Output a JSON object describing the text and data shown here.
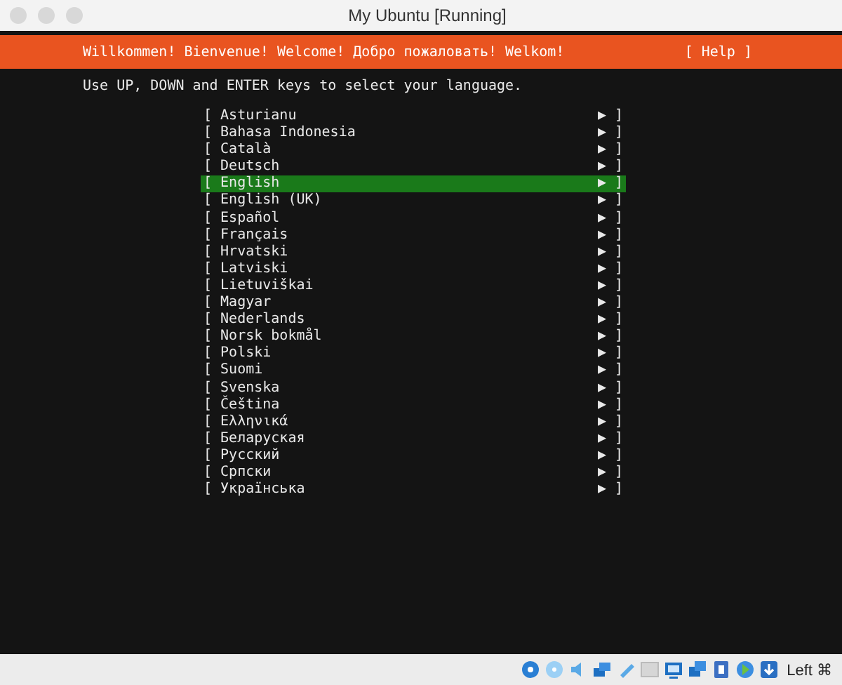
{
  "window": {
    "title": "My Ubuntu [Running]"
  },
  "header": {
    "welcome": "Willkommen! Bienvenue! Welcome! Добро пожаловать! Welkom!",
    "help": "[ Help ]"
  },
  "instruction": "Use UP, DOWN and ENTER keys to select your language.",
  "languages": [
    {
      "open": "[",
      "label": "Asturianu",
      "close": "▶ ]",
      "selected": false
    },
    {
      "open": "[",
      "label": "Bahasa Indonesia",
      "close": "▶ ]",
      "selected": false
    },
    {
      "open": "[",
      "label": "Català",
      "close": "▶ ]",
      "selected": false
    },
    {
      "open": "[",
      "label": "Deutsch",
      "close": "▶ ]",
      "selected": false
    },
    {
      "open": "[",
      "label": "English",
      "close": "▶ ]",
      "selected": true
    },
    {
      "open": "[",
      "label": "English (UK)",
      "close": "▶ ]",
      "selected": false
    },
    {
      "open": "[",
      "label": "Español",
      "close": "▶ ]",
      "selected": false
    },
    {
      "open": "[",
      "label": "Français",
      "close": "▶ ]",
      "selected": false
    },
    {
      "open": "[",
      "label": "Hrvatski",
      "close": "▶ ]",
      "selected": false
    },
    {
      "open": "[",
      "label": "Latviski",
      "close": "▶ ]",
      "selected": false
    },
    {
      "open": "[",
      "label": "Lietuviškai",
      "close": "▶ ]",
      "selected": false
    },
    {
      "open": "[",
      "label": "Magyar",
      "close": "▶ ]",
      "selected": false
    },
    {
      "open": "[",
      "label": "Nederlands",
      "close": "▶ ]",
      "selected": false
    },
    {
      "open": "[",
      "label": "Norsk bokmål",
      "close": "▶ ]",
      "selected": false
    },
    {
      "open": "[",
      "label": "Polski",
      "close": "▶ ]",
      "selected": false
    },
    {
      "open": "[",
      "label": "Suomi",
      "close": "▶ ]",
      "selected": false
    },
    {
      "open": "[",
      "label": "Svenska",
      "close": "▶ ]",
      "selected": false
    },
    {
      "open": "[",
      "label": "Čeština",
      "close": "▶ ]",
      "selected": false
    },
    {
      "open": "[",
      "label": "Ελληνικά",
      "close": "▶ ]",
      "selected": false
    },
    {
      "open": "[",
      "label": "Беларуская",
      "close": "▶ ]",
      "selected": false
    },
    {
      "open": "[",
      "label": "Русский",
      "close": "▶ ]",
      "selected": false
    },
    {
      "open": "[",
      "label": "Српски",
      "close": "▶ ]",
      "selected": false
    },
    {
      "open": "[",
      "label": "Українська",
      "close": "▶ ]",
      "selected": false
    }
  ],
  "status_bar": {
    "host_key": "Left ⌘"
  }
}
